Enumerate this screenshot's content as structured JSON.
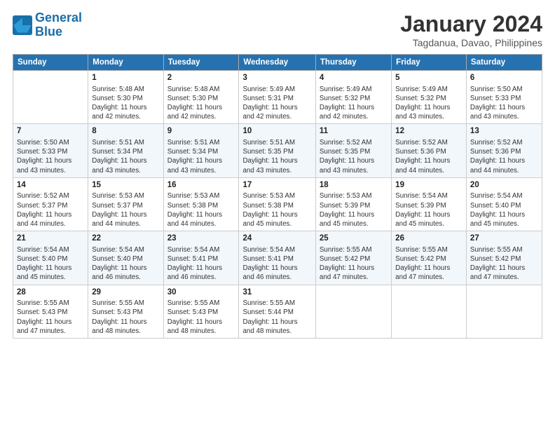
{
  "logo": {
    "line1": "General",
    "line2": "Blue"
  },
  "title": "January 2024",
  "subtitle": "Tagdanua, Davao, Philippines",
  "days_header": [
    "Sunday",
    "Monday",
    "Tuesday",
    "Wednesday",
    "Thursday",
    "Friday",
    "Saturday"
  ],
  "weeks": [
    [
      {
        "num": "",
        "info": ""
      },
      {
        "num": "1",
        "info": "Sunrise: 5:48 AM\nSunset: 5:30 PM\nDaylight: 11 hours\nand 42 minutes."
      },
      {
        "num": "2",
        "info": "Sunrise: 5:48 AM\nSunset: 5:30 PM\nDaylight: 11 hours\nand 42 minutes."
      },
      {
        "num": "3",
        "info": "Sunrise: 5:49 AM\nSunset: 5:31 PM\nDaylight: 11 hours\nand 42 minutes."
      },
      {
        "num": "4",
        "info": "Sunrise: 5:49 AM\nSunset: 5:32 PM\nDaylight: 11 hours\nand 42 minutes."
      },
      {
        "num": "5",
        "info": "Sunrise: 5:49 AM\nSunset: 5:32 PM\nDaylight: 11 hours\nand 43 minutes."
      },
      {
        "num": "6",
        "info": "Sunrise: 5:50 AM\nSunset: 5:33 PM\nDaylight: 11 hours\nand 43 minutes."
      }
    ],
    [
      {
        "num": "7",
        "info": "Sunrise: 5:50 AM\nSunset: 5:33 PM\nDaylight: 11 hours\nand 43 minutes."
      },
      {
        "num": "8",
        "info": "Sunrise: 5:51 AM\nSunset: 5:34 PM\nDaylight: 11 hours\nand 43 minutes."
      },
      {
        "num": "9",
        "info": "Sunrise: 5:51 AM\nSunset: 5:34 PM\nDaylight: 11 hours\nand 43 minutes."
      },
      {
        "num": "10",
        "info": "Sunrise: 5:51 AM\nSunset: 5:35 PM\nDaylight: 11 hours\nand 43 minutes."
      },
      {
        "num": "11",
        "info": "Sunrise: 5:52 AM\nSunset: 5:35 PM\nDaylight: 11 hours\nand 43 minutes."
      },
      {
        "num": "12",
        "info": "Sunrise: 5:52 AM\nSunset: 5:36 PM\nDaylight: 11 hours\nand 44 minutes."
      },
      {
        "num": "13",
        "info": "Sunrise: 5:52 AM\nSunset: 5:36 PM\nDaylight: 11 hours\nand 44 minutes."
      }
    ],
    [
      {
        "num": "14",
        "info": "Sunrise: 5:52 AM\nSunset: 5:37 PM\nDaylight: 11 hours\nand 44 minutes."
      },
      {
        "num": "15",
        "info": "Sunrise: 5:53 AM\nSunset: 5:37 PM\nDaylight: 11 hours\nand 44 minutes."
      },
      {
        "num": "16",
        "info": "Sunrise: 5:53 AM\nSunset: 5:38 PM\nDaylight: 11 hours\nand 44 minutes."
      },
      {
        "num": "17",
        "info": "Sunrise: 5:53 AM\nSunset: 5:38 PM\nDaylight: 11 hours\nand 45 minutes."
      },
      {
        "num": "18",
        "info": "Sunrise: 5:53 AM\nSunset: 5:39 PM\nDaylight: 11 hours\nand 45 minutes."
      },
      {
        "num": "19",
        "info": "Sunrise: 5:54 AM\nSunset: 5:39 PM\nDaylight: 11 hours\nand 45 minutes."
      },
      {
        "num": "20",
        "info": "Sunrise: 5:54 AM\nSunset: 5:40 PM\nDaylight: 11 hours\nand 45 minutes."
      }
    ],
    [
      {
        "num": "21",
        "info": "Sunrise: 5:54 AM\nSunset: 5:40 PM\nDaylight: 11 hours\nand 45 minutes."
      },
      {
        "num": "22",
        "info": "Sunrise: 5:54 AM\nSunset: 5:40 PM\nDaylight: 11 hours\nand 46 minutes."
      },
      {
        "num": "23",
        "info": "Sunrise: 5:54 AM\nSunset: 5:41 PM\nDaylight: 11 hours\nand 46 minutes."
      },
      {
        "num": "24",
        "info": "Sunrise: 5:54 AM\nSunset: 5:41 PM\nDaylight: 11 hours\nand 46 minutes."
      },
      {
        "num": "25",
        "info": "Sunrise: 5:55 AM\nSunset: 5:42 PM\nDaylight: 11 hours\nand 47 minutes."
      },
      {
        "num": "26",
        "info": "Sunrise: 5:55 AM\nSunset: 5:42 PM\nDaylight: 11 hours\nand 47 minutes."
      },
      {
        "num": "27",
        "info": "Sunrise: 5:55 AM\nSunset: 5:42 PM\nDaylight: 11 hours\nand 47 minutes."
      }
    ],
    [
      {
        "num": "28",
        "info": "Sunrise: 5:55 AM\nSunset: 5:43 PM\nDaylight: 11 hours\nand 47 minutes."
      },
      {
        "num": "29",
        "info": "Sunrise: 5:55 AM\nSunset: 5:43 PM\nDaylight: 11 hours\nand 48 minutes."
      },
      {
        "num": "30",
        "info": "Sunrise: 5:55 AM\nSunset: 5:43 PM\nDaylight: 11 hours\nand 48 minutes."
      },
      {
        "num": "31",
        "info": "Sunrise: 5:55 AM\nSunset: 5:44 PM\nDaylight: 11 hours\nand 48 minutes."
      },
      {
        "num": "",
        "info": ""
      },
      {
        "num": "",
        "info": ""
      },
      {
        "num": "",
        "info": ""
      }
    ]
  ]
}
